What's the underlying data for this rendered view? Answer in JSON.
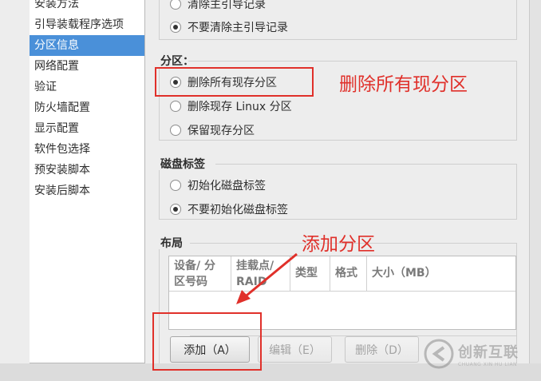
{
  "sidebar": {
    "items": [
      {
        "label": "安装方法",
        "selected": false
      },
      {
        "label": "引导装载程序选项",
        "selected": false
      },
      {
        "label": "分区信息",
        "selected": true
      },
      {
        "label": "网络配置",
        "selected": false
      },
      {
        "label": "验证",
        "selected": false
      },
      {
        "label": "防火墙配置",
        "selected": false
      },
      {
        "label": "显示配置",
        "selected": false
      },
      {
        "label": "软件包选择",
        "selected": false
      },
      {
        "label": "预安装脚本",
        "selected": false
      },
      {
        "label": "安装后脚本",
        "selected": false
      }
    ]
  },
  "mbr": {
    "options": [
      {
        "label": "清除主引导记录",
        "checked": false
      },
      {
        "label": "不要清除主引导记录",
        "checked": true
      }
    ]
  },
  "partitions": {
    "title": "分区：",
    "options": [
      {
        "label": "删除所有现存分区",
        "checked": true
      },
      {
        "label": "删除现存 Linux 分区",
        "checked": false
      },
      {
        "label": "保留现存分区",
        "checked": false
      }
    ]
  },
  "disk_label": {
    "title": "磁盘标签",
    "options": [
      {
        "label": "初始化磁盘标签",
        "checked": false
      },
      {
        "label": "不要初始化磁盘标签",
        "checked": true
      }
    ]
  },
  "layout": {
    "title": "布局",
    "columns": [
      "设备/ 分区号码",
      "挂载点/ RAID",
      "类型",
      "格式",
      "大小（MB）"
    ],
    "rows": []
  },
  "buttons": {
    "add": "添加（A）",
    "edit": "编辑（E）",
    "delete": "删除（D）"
  },
  "annotations": {
    "delete_all": "删除所有现分区",
    "add_partition": "添加分区",
    "color": "#e0302a"
  },
  "watermark": {
    "text": "创新互联",
    "sub": "CHUANG XIN HU LIAN"
  }
}
